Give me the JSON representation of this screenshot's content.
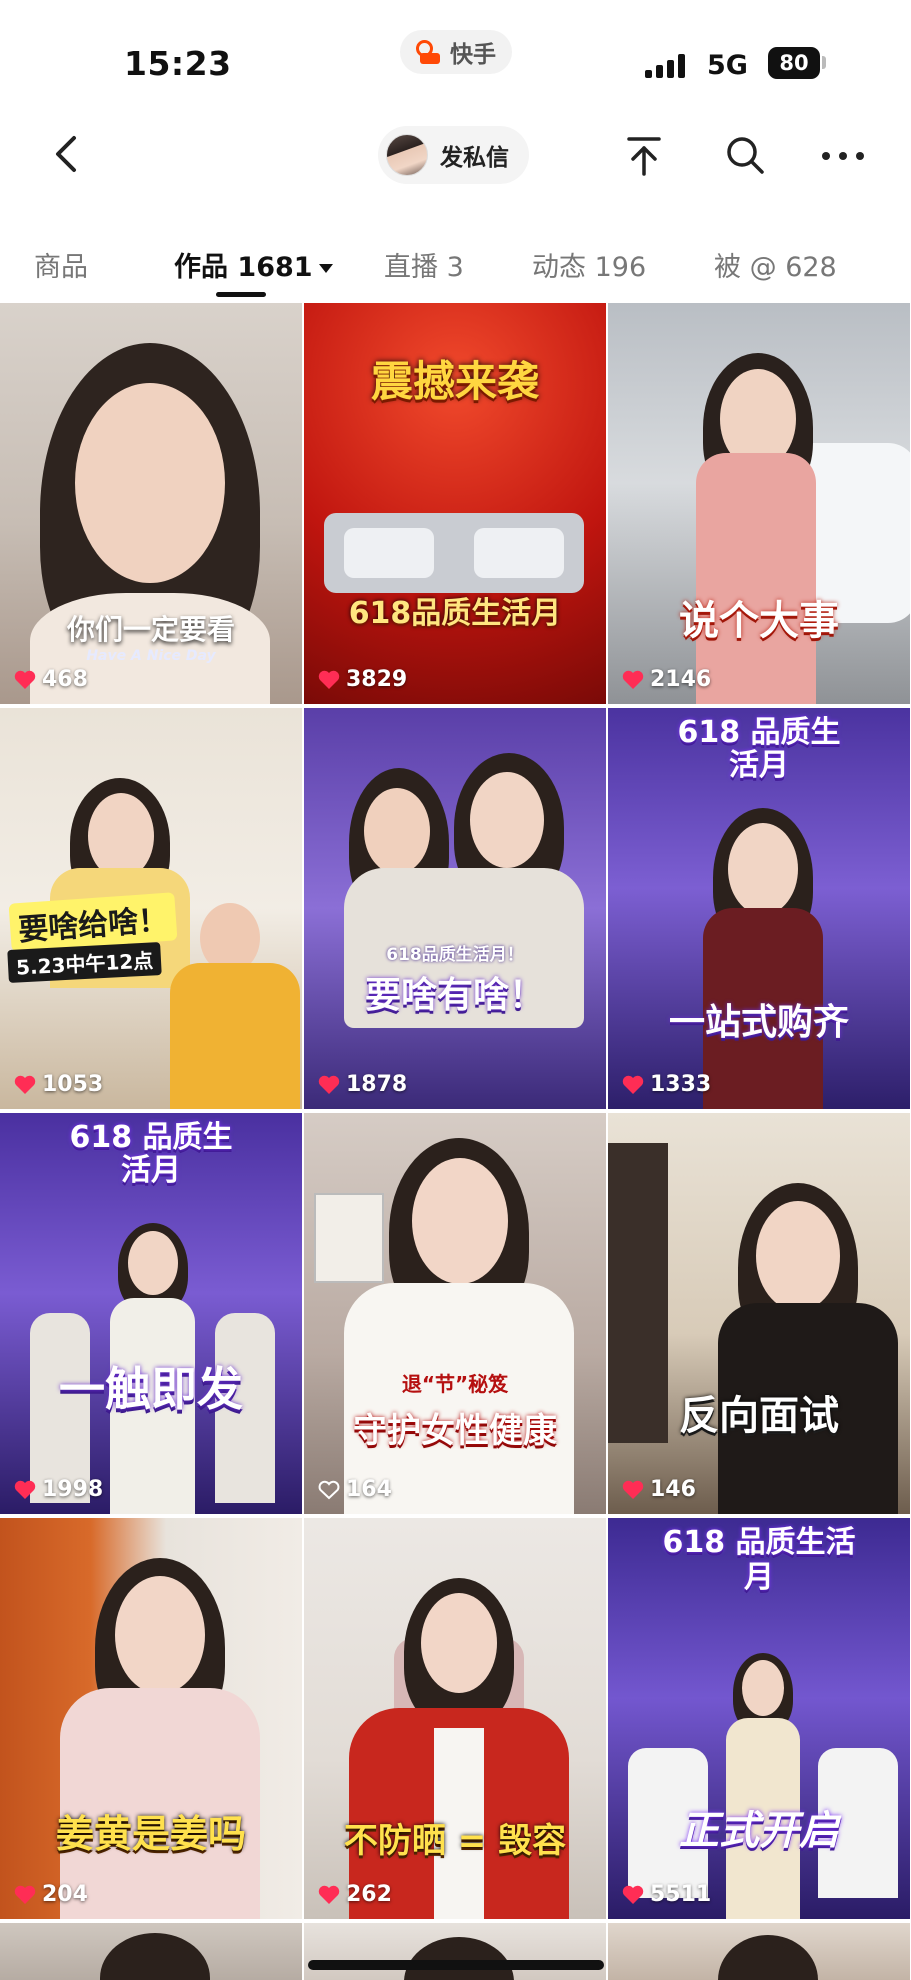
{
  "status_bar": {
    "time": "15:23",
    "app_name": "快手",
    "network": "5G",
    "battery": "80"
  },
  "header": {
    "dm_label": "发私信"
  },
  "tabs": [
    {
      "label": "商品",
      "count": ""
    },
    {
      "label": "作品",
      "count": "1681"
    },
    {
      "label": "直播",
      "count": "3"
    },
    {
      "label": "动态",
      "count": "196"
    },
    {
      "label": "被 @",
      "count": "628"
    }
  ],
  "videos": [
    {
      "caption": "你们一定要看",
      "sub": "Have A Nice Day",
      "likes": "468"
    },
    {
      "caption": "震撼来袭",
      "sub": "618品质生活月",
      "likes": "3829"
    },
    {
      "caption": "说个大事",
      "sub": "",
      "likes": "2146"
    },
    {
      "caption": "要啥给啥！",
      "sub": "5.23中午12点",
      "likes": "1053"
    },
    {
      "caption": "要啥有啥！",
      "sub": "618品质生活月！",
      "likes": "1878"
    },
    {
      "caption": "一站式购齐",
      "sub": "618 品质生活月",
      "likes": "1333"
    },
    {
      "caption": "一触即发",
      "sub": "618 品质生活月",
      "likes": "1998"
    },
    {
      "caption": "守护女性健康",
      "sub": "退“节”秘笈",
      "likes": "164"
    },
    {
      "caption": "反向面试",
      "sub": "",
      "likes": "146"
    },
    {
      "caption": "姜黄是姜吗",
      "sub": "",
      "likes": "204"
    },
    {
      "caption": "不防晒 = 毁容",
      "sub": "",
      "likes": "262"
    },
    {
      "caption": "正式开启",
      "sub": "618 品质生活月",
      "likes": "5511"
    }
  ],
  "colors": {
    "accent": "#ff4906",
    "heart": "#ff2d55",
    "purple": "#7b2ff7",
    "red": "#d71f18",
    "gold": "#ffd640"
  },
  "icons": [
    "back-icon",
    "pin-top-icon",
    "search-icon",
    "more-icon",
    "heart-icon",
    "kuaishou-logo-icon"
  ]
}
